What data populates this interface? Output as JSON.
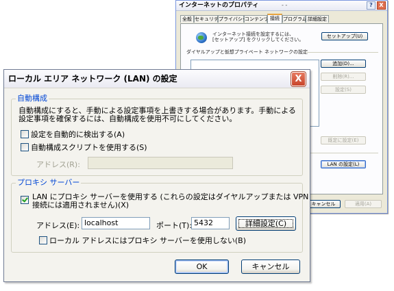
{
  "background_window": {
    "title": "インターネットのプロパティ",
    "subtitle": "- -",
    "help_button": "?",
    "close_button": "X",
    "tabs": [
      "全般",
      "セキュリティ",
      "プライバシー",
      "コンテンツ",
      "接続",
      "プログラム",
      "詳細設定"
    ],
    "active_tab": "接続",
    "setup_text_line1": "インターネット接続を設定するには、",
    "setup_text_line2": "[セットアップ] をクリックしてください。",
    "setup_button": "セットアップ(U)",
    "dialup_label": "ダイヤルアップと仮想プライベート ネットワークの設定",
    "add_button": "追加(D)...",
    "remove_button": "削除(R)...",
    "settings_button": "設定(S)",
    "default_button": "既定に設定(E)",
    "lan_settings_button": "LAN の設定(L)",
    "cancel_button": "キャンセル",
    "apply_button": "適用(A)"
  },
  "dialog": {
    "title": "ローカル エリア ネットワーク (LAN) の設定",
    "close_icon": "X",
    "auto_config": {
      "legend": "自動構成",
      "description_line1": "自動構成にすると、手動による設定事項を上書きする場合があります。手動による",
      "description_line2": "設定事項を確保するには、自動構成を使用不可にしてください。",
      "auto_detect_label": "設定を自動的に検出する(A)",
      "auto_detect_checked": false,
      "use_script_label": "自動構成スクリプトを使用する(S)",
      "use_script_checked": false,
      "address_label": "アドレス(R):",
      "address_value": ""
    },
    "proxy": {
      "legend": "プロキシ サーバー",
      "use_proxy_label_line1": "LAN にプロキシ サーバーを使用する (これらの設定はダイヤルアップまたは VPN",
      "use_proxy_label_line2": "接続には適用されません)(X)",
      "use_proxy_checked": true,
      "address_label": "アドレス(E):",
      "address_value": "localhost",
      "port_label": "ポート(T):",
      "port_value": "5432",
      "advanced_button": "詳細設定(C)",
      "bypass_local_label": "ローカル アドレスにはプロキシ サーバーを使用しない(B)",
      "bypass_local_checked": false
    },
    "ok_button": "OK",
    "cancel_button": "キャンセル"
  },
  "colors": {
    "group_legend": "#0046d5",
    "close_button": "#c8442a",
    "checkmark": "#21a121"
  }
}
